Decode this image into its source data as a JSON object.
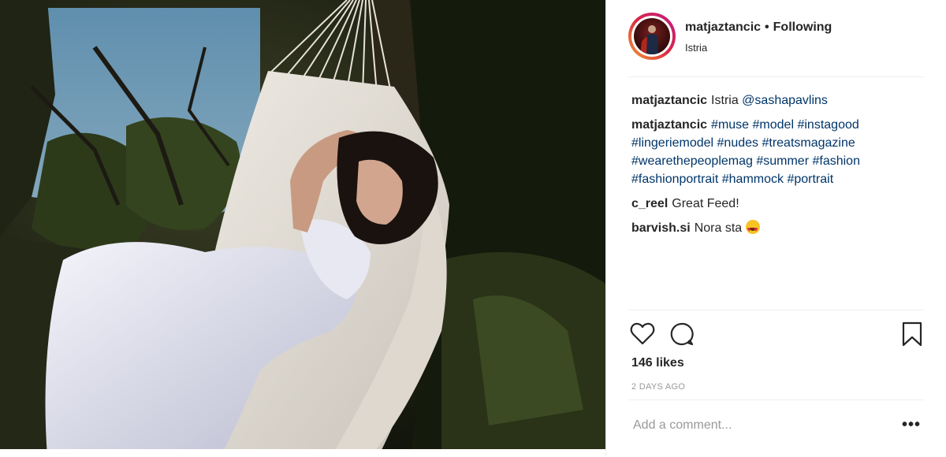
{
  "post": {
    "username": "matjaztancic",
    "separator": "•",
    "follow_status": "Following",
    "location": "Istria"
  },
  "comments": [
    {
      "user": "matjaztancic",
      "parts": [
        {
          "text": "Istria "
        },
        {
          "tag": "@sashapavlins"
        }
      ]
    },
    {
      "user": "matjaztancic",
      "parts": [
        {
          "tag": "#muse"
        },
        {
          "text": " "
        },
        {
          "tag": "#model"
        },
        {
          "text": " "
        },
        {
          "tag": "#instagood"
        },
        {
          "text": " "
        },
        {
          "tag": "#lingeriemodel"
        },
        {
          "text": " "
        },
        {
          "tag": "#nudes"
        },
        {
          "text": " "
        },
        {
          "tag": "#treatsmagazine"
        },
        {
          "text": " "
        },
        {
          "tag": "#wearethepeoplemag"
        },
        {
          "text": " "
        },
        {
          "tag": "#summer"
        },
        {
          "text": " "
        },
        {
          "tag": "#fashion"
        },
        {
          "text": " "
        },
        {
          "tag": "#fashionportrait"
        },
        {
          "text": " "
        },
        {
          "tag": "#hammock"
        },
        {
          "text": " "
        },
        {
          "tag": "#portrait"
        }
      ]
    },
    {
      "user": "c_reel",
      "parts": [
        {
          "text": "Great Feed!"
        }
      ]
    },
    {
      "user": "barvish.si",
      "parts": [
        {
          "text": "Nora sta "
        },
        {
          "emoji": "heart-eyes-emoji"
        }
      ]
    }
  ],
  "actions": {
    "like_icon": "heart-icon",
    "comment_icon": "speech-bubble-icon",
    "save_icon": "bookmark-icon"
  },
  "likes": "146 likes",
  "timestamp": "2 DAYS AGO",
  "add_comment": {
    "placeholder": "Add a comment...",
    "more_label": "•••"
  },
  "colors": {
    "hashtag": "#003569",
    "text": "#262626",
    "muted": "#999999",
    "divider": "#efefef"
  }
}
